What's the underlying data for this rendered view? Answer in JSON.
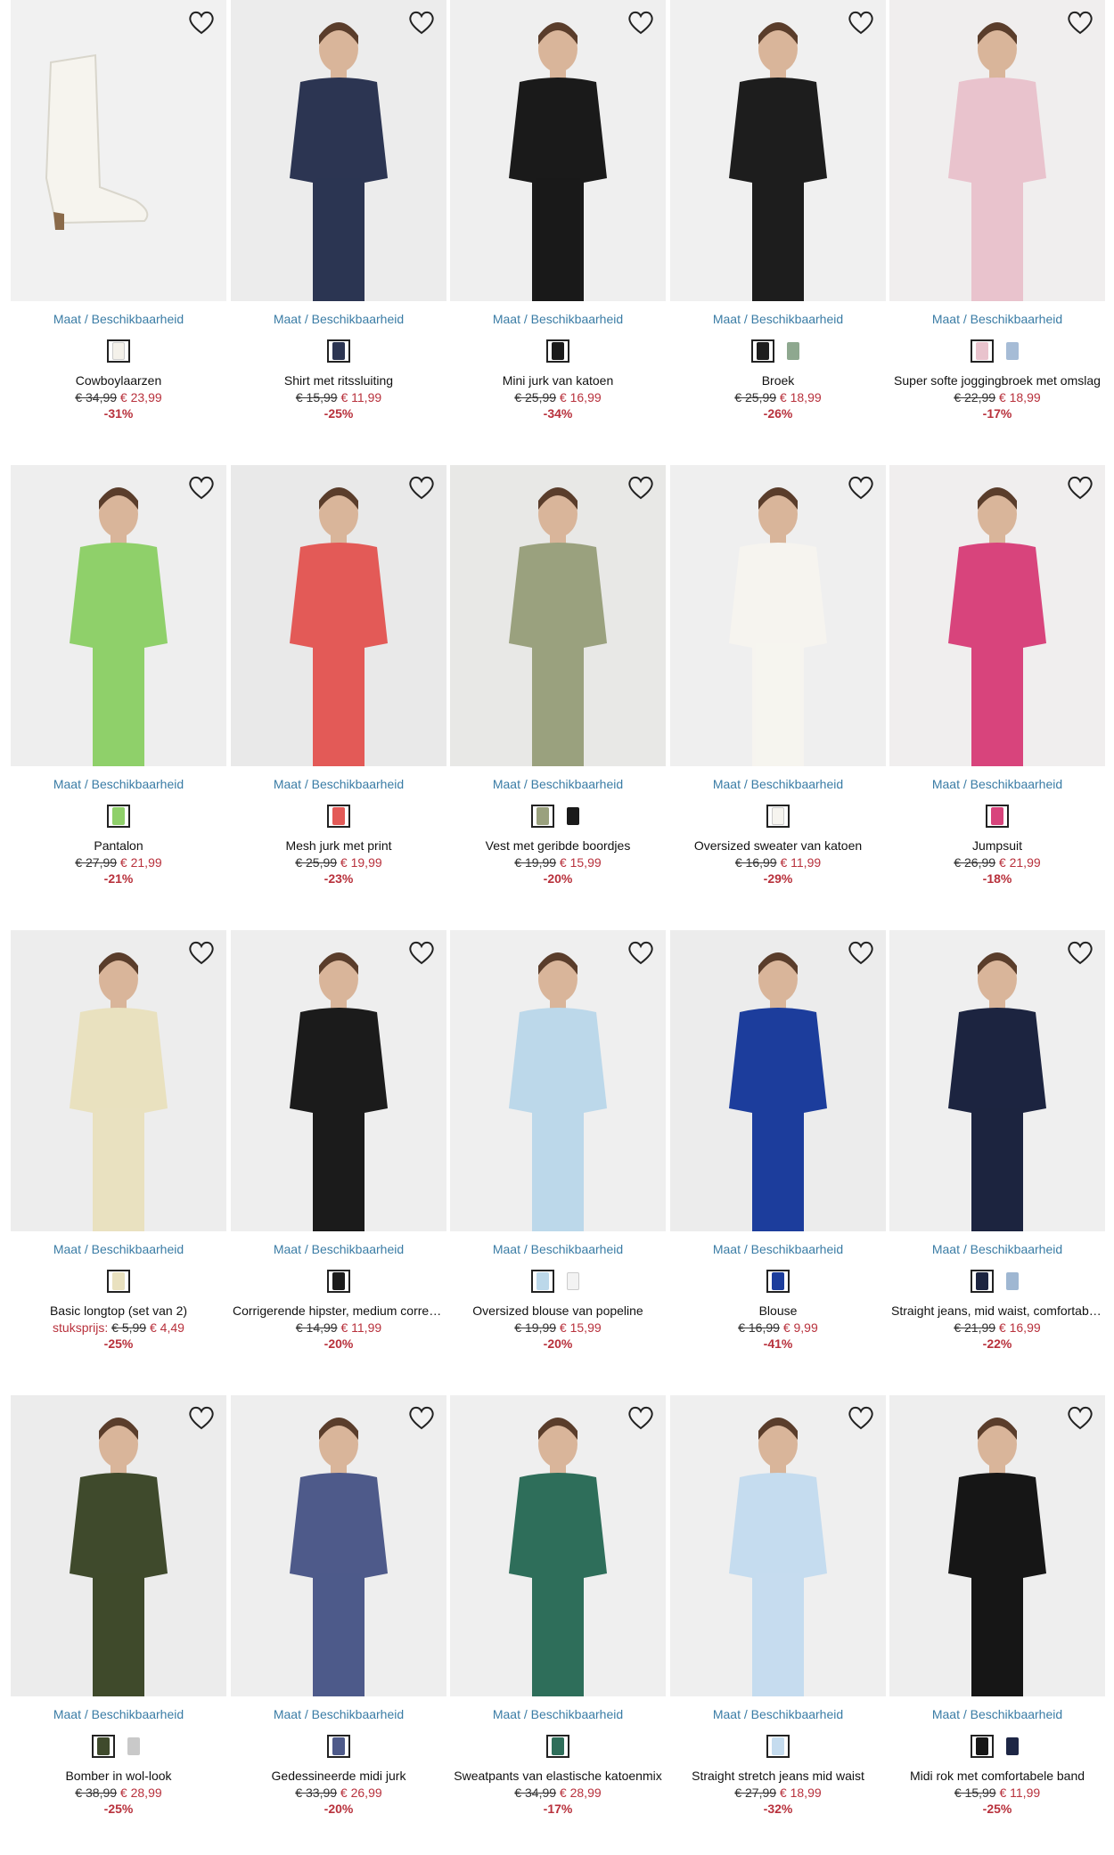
{
  "avail_label": "Maat / Beschikbaarheid",
  "products": [
    {
      "name": "Cowboylaarzen",
      "old_price": "€ 34,99",
      "new_price": "€ 23,99",
      "discount": "-31%",
      "bg": "#f1f1f1",
      "swatches": [
        "#f4f1ea"
      ],
      "icon": "boot-image"
    },
    {
      "name": "Shirt met ritssluiting",
      "old_price": "€ 15,99",
      "new_price": "€ 11,99",
      "discount": "-25%",
      "bg": "#ececec",
      "swatches": [
        "#2c3552"
      ],
      "icon": "model-image"
    },
    {
      "name": "Mini jurk van katoen",
      "old_price": "€ 25,99",
      "new_price": "€ 16,99",
      "discount": "-34%",
      "bg": "#efefef",
      "swatches": [
        "#1a1a1a"
      ],
      "icon": "model-image"
    },
    {
      "name": "Broek",
      "old_price": "€ 25,99",
      "new_price": "€ 18,99",
      "discount": "-26%",
      "bg": "#f0f0f0",
      "swatches": [
        "#1d1d1d",
        "#8ea88f"
      ],
      "icon": "model-image"
    },
    {
      "name": "Super softe joggingbroek met omslag",
      "old_price": "€ 22,99",
      "new_price": "€ 18,99",
      "discount": "-17%",
      "bg": "#f0eeee",
      "swatches": [
        "#e9c3cd",
        "#a6bcd6"
      ],
      "icon": "model-image"
    },
    {
      "name": "Pantalon",
      "old_price": "€ 27,99",
      "new_price": "€ 21,99",
      "discount": "-21%",
      "bg": "#eeeeee",
      "swatches": [
        "#8fd06a"
      ],
      "icon": "model-image"
    },
    {
      "name": "Mesh jurk met print",
      "old_price": "€ 25,99",
      "new_price": "€ 19,99",
      "discount": "-23%",
      "bg": "#e9e9e9",
      "swatches": [
        "#e35a57"
      ],
      "icon": "model-image"
    },
    {
      "name": "Vest met geribde boordjes",
      "old_price": "€ 19,99",
      "new_price": "€ 15,99",
      "discount": "-20%",
      "bg": "#e8e8e6",
      "swatches": [
        "#9aa17e",
        "#1a1a1a"
      ],
      "icon": "model-image"
    },
    {
      "name": "Oversized sweater van katoen",
      "old_price": "€ 16,99",
      "new_price": "€ 11,99",
      "discount": "-29%",
      "bg": "#efefef",
      "swatches": [
        "#f6f4ef"
      ],
      "icon": "model-image"
    },
    {
      "name": "Jumpsuit",
      "old_price": "€ 26,99",
      "new_price": "€ 21,99",
      "discount": "-18%",
      "bg": "#f0eeee",
      "swatches": [
        "#d8447c"
      ],
      "icon": "model-image"
    },
    {
      "name": "Basic longtop (set van 2)",
      "price_prefix": "stuksprijs:",
      "old_price": "€ 5,99",
      "new_price": "€ 4,49",
      "discount": "-25%",
      "bg": "#ededed",
      "swatches": [
        "#e9e1bf"
      ],
      "icon": "model-image"
    },
    {
      "name": "Corrigerende hipster, medium correctie",
      "old_price": "€ 14,99",
      "new_price": "€ 11,99",
      "discount": "-20%",
      "bg": "#eeeeee",
      "swatches": [
        "#1b1b1b"
      ],
      "icon": "model-image"
    },
    {
      "name": "Oversized blouse van popeline",
      "old_price": "€ 19,99",
      "new_price": "€ 15,99",
      "discount": "-20%",
      "bg": "#efefef",
      "swatches": [
        "#bcd8ea",
        "#f3f3f3"
      ],
      "icon": "model-image"
    },
    {
      "name": "Blouse",
      "old_price": "€ 16,99",
      "new_price": "€ 9,99",
      "discount": "-41%",
      "bg": "#ececec",
      "swatches": [
        "#1c3d9c"
      ],
      "icon": "model-image"
    },
    {
      "name": "Straight jeans, mid waist, comfortabele band",
      "old_price": "€ 21,99",
      "new_price": "€ 16,99",
      "discount": "-22%",
      "bg": "#efefef",
      "swatches": [
        "#1c2440",
        "#9fb7d2"
      ],
      "icon": "model-image"
    },
    {
      "name": "Bomber in wol-look",
      "old_price": "€ 38,99",
      "new_price": "€ 28,99",
      "discount": "-25%",
      "bg": "#ececec",
      "swatches": [
        "#3f4a2c",
        "#c9c9c9"
      ],
      "icon": "model-image"
    },
    {
      "name": "Gedessineerde midi jurk",
      "old_price": "€ 33,99",
      "new_price": "€ 26,99",
      "discount": "-20%",
      "bg": "#eeeeee",
      "swatches": [
        "#4e5a8a"
      ],
      "icon": "model-image"
    },
    {
      "name": "Sweatpants van elastische katoenmix",
      "old_price": "€ 34,99",
      "new_price": "€ 28,99",
      "discount": "-17%",
      "bg": "#efefef",
      "swatches": [
        "#2e6e5a"
      ],
      "icon": "model-image"
    },
    {
      "name": "Straight stretch jeans mid waist",
      "old_price": "€ 27,99",
      "new_price": "€ 18,99",
      "discount": "-32%",
      "bg": "#efefef",
      "swatches": [
        "#c5dcef"
      ],
      "icon": "model-image"
    },
    {
      "name": "Midi rok met comfortabele band",
      "old_price": "€ 15,99",
      "new_price": "€ 11,99",
      "discount": "-25%",
      "bg": "#eeeeee",
      "swatches": [
        "#161616",
        "#1d2645"
      ],
      "icon": "model-image"
    }
  ]
}
